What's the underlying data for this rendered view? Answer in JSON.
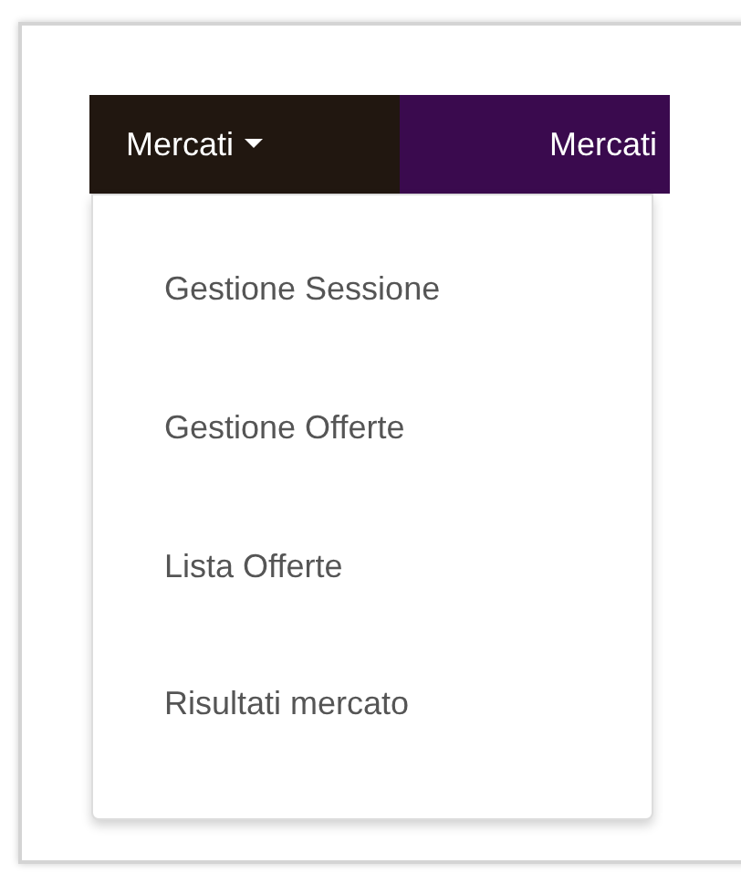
{
  "navbar": {
    "items": [
      {
        "label": "Mercati",
        "kind": "dropdown",
        "expanded": true
      },
      {
        "label": "Mercati",
        "kind": "link"
      }
    ]
  },
  "dropdown_menu": {
    "items": [
      {
        "label": "Gestione Sessione"
      },
      {
        "label": "Gestione Offerte"
      },
      {
        "label": "Lista Offerte"
      },
      {
        "label": "Risultati mercato"
      }
    ]
  }
}
